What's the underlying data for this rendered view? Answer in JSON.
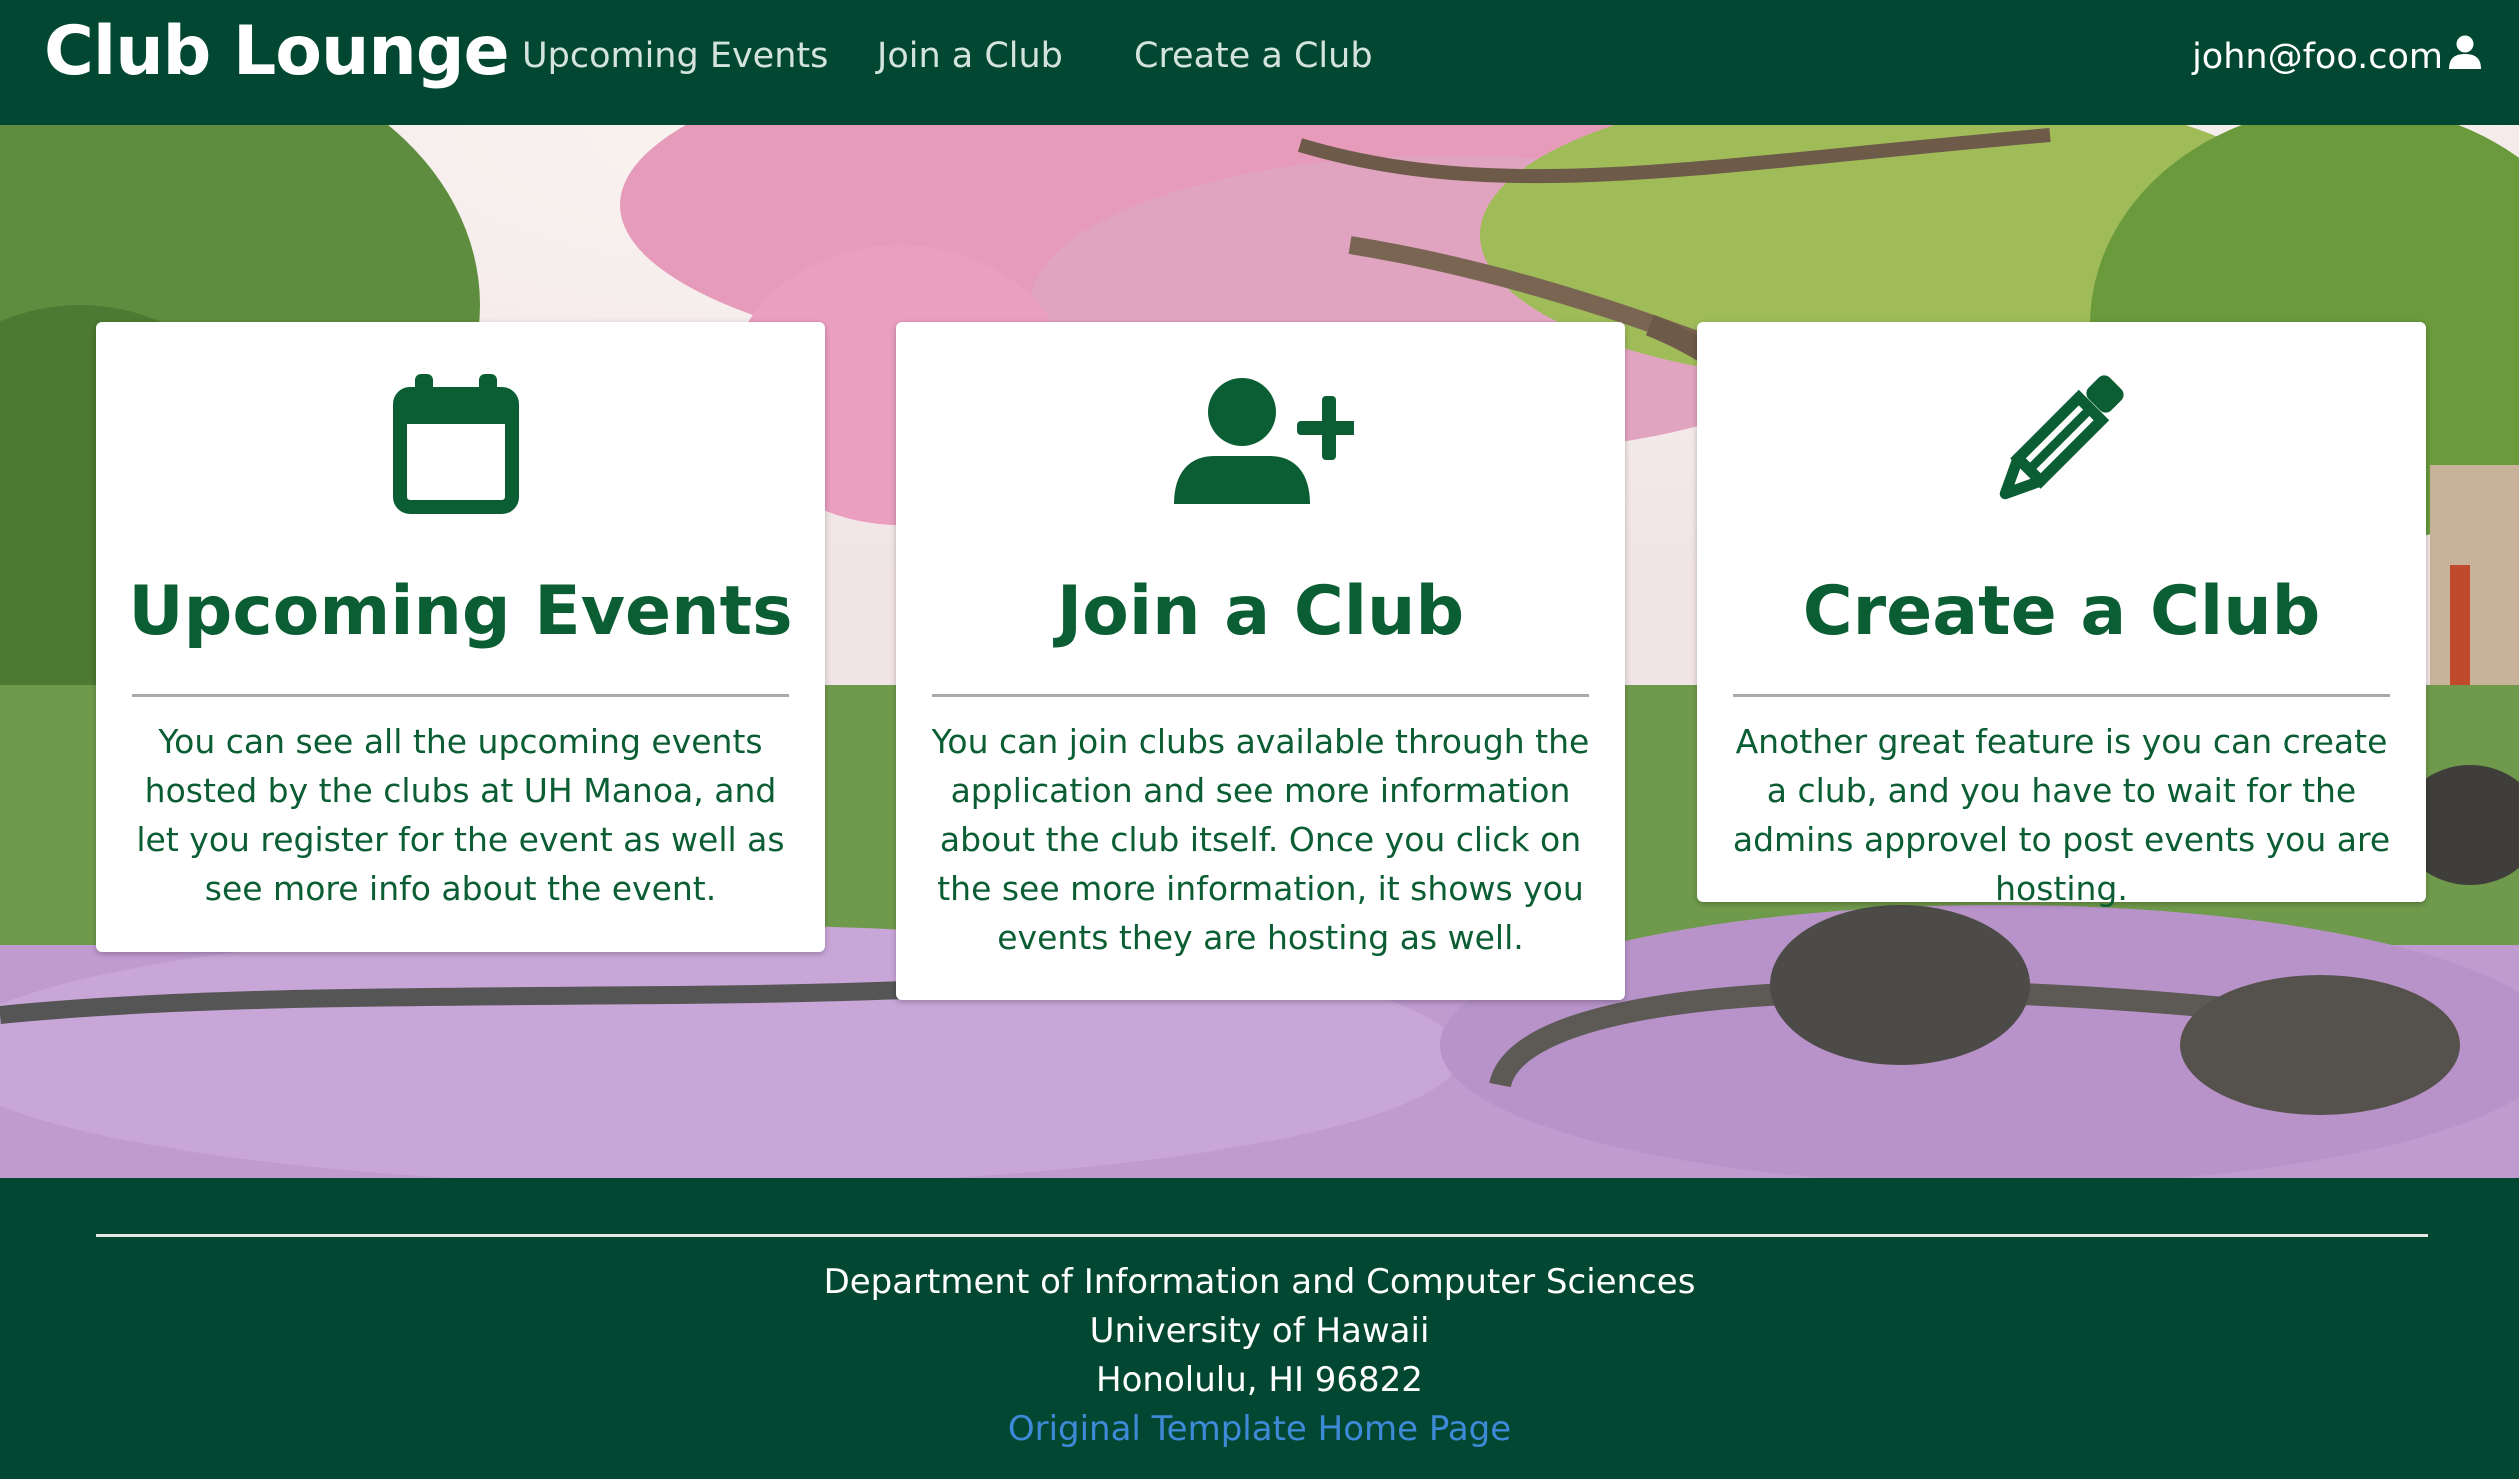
{
  "navbar": {
    "brand": "Club Lounge",
    "links": [
      "Upcoming Events",
      "Join a Club",
      "Create a Club"
    ],
    "user_email": "john@foo.com",
    "user_icon": "user-icon"
  },
  "cards": [
    {
      "icon": "calendar-icon",
      "title": "Upcoming Events",
      "description": "You can see all the upcoming events hosted by the clubs at UH Manoa, and let you register for the event as well as see more info about the event."
    },
    {
      "icon": "user-plus-icon",
      "title": "Join a Club",
      "description": "You can join clubs available through the application and see more information about the club itself. Once you click on the see more information, it shows you events they are hosting as well."
    },
    {
      "icon": "pencil-icon",
      "title": "Create a Club",
      "description": "Another great feature is you can create a club, and you have to wait for the admins approvel to post events you are hosting."
    }
  ],
  "footer": {
    "line1": "Department of Information and Computer Sciences",
    "line2": "University of Hawaii",
    "line3": "Honolulu, HI 96822",
    "link": "Original Template Home Page"
  },
  "colors": {
    "primary": "#024731",
    "accent_text": "#0b5e33",
    "link": "#3f8ad8"
  }
}
